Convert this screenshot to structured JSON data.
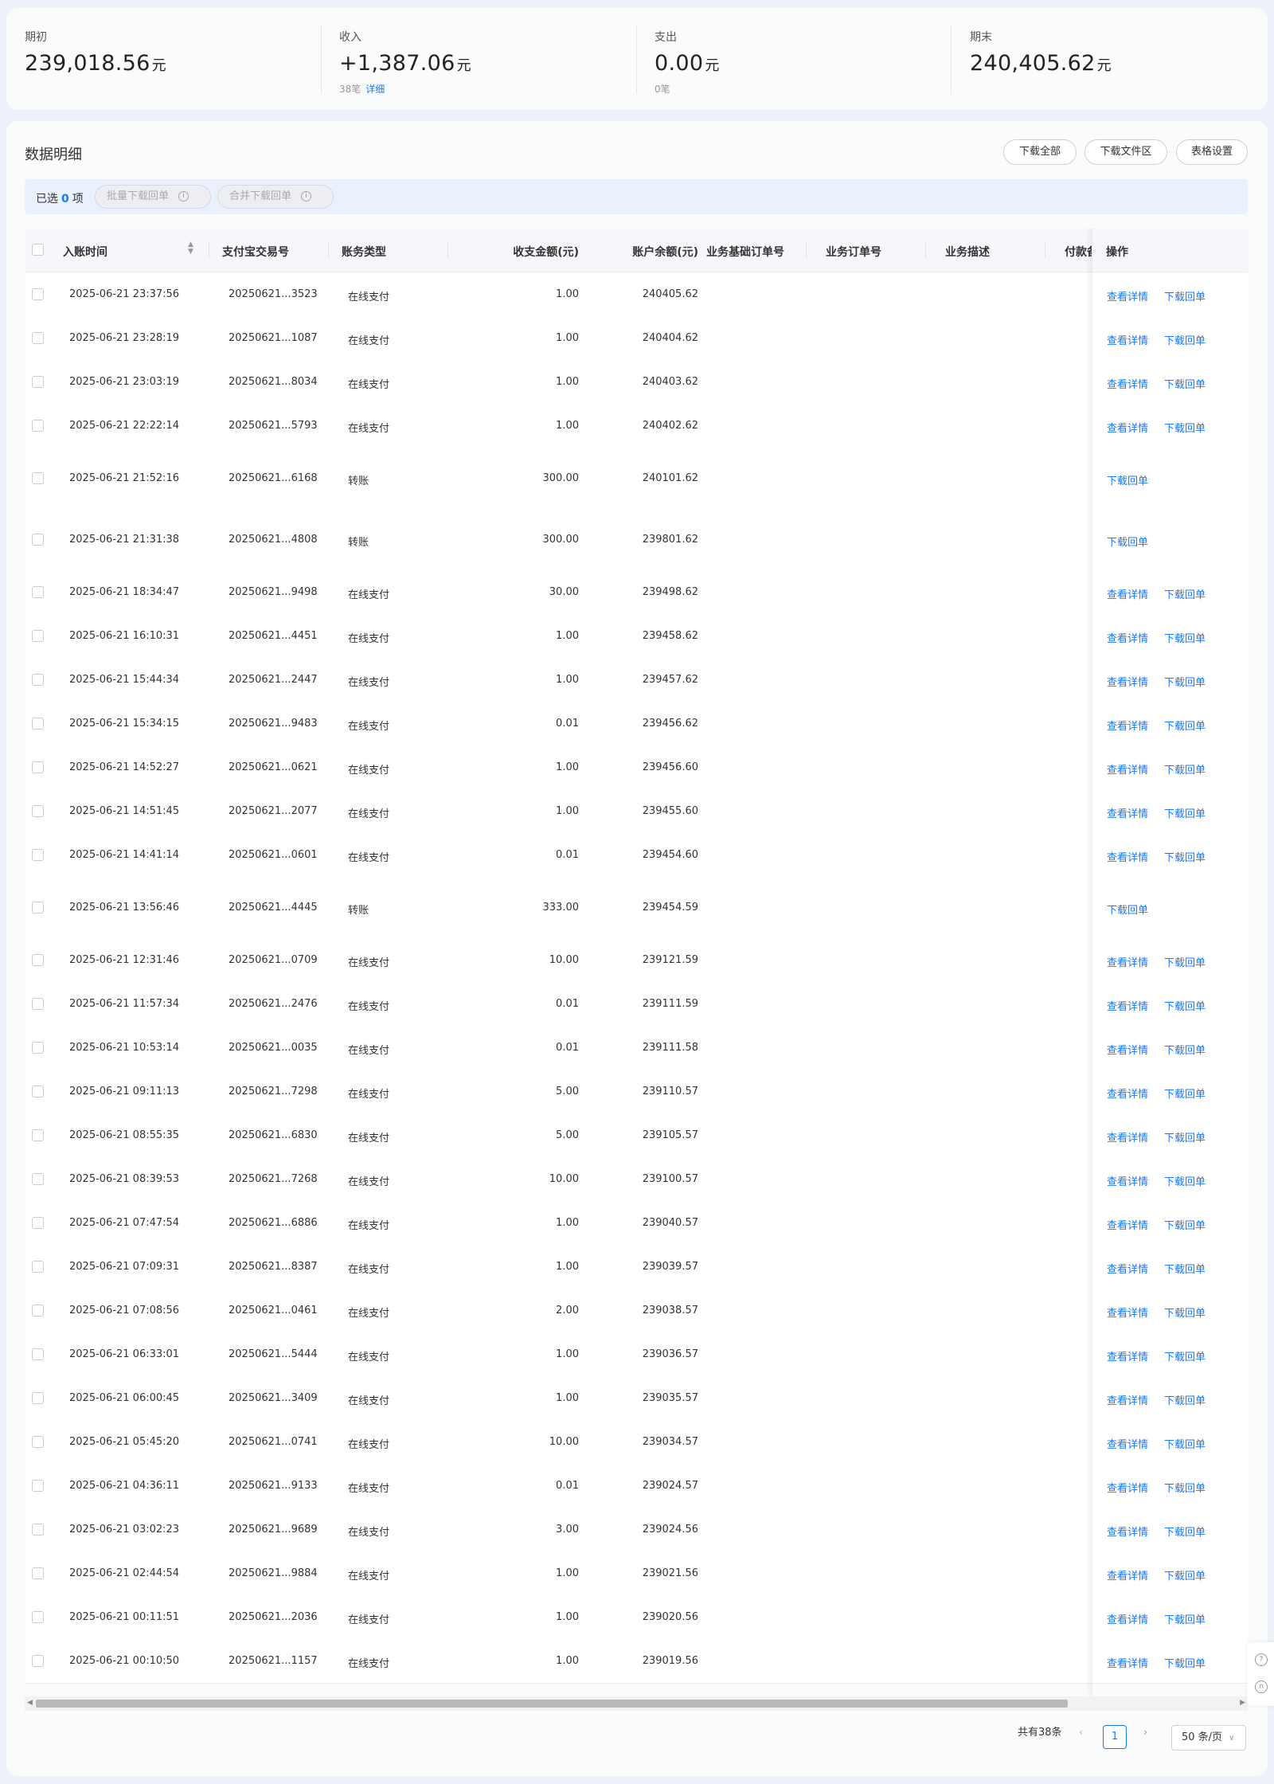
{
  "summary": [
    {
      "label": "期初",
      "value": "239,018.56",
      "unit": "元",
      "sub_count": "",
      "sub_link": ""
    },
    {
      "label": "收入",
      "value": "+1,387.06",
      "unit": "元",
      "sub_count": "38笔",
      "sub_link": "详细"
    },
    {
      "label": "支出",
      "value": "0.00",
      "unit": "元",
      "sub_count": "0笔",
      "sub_link": ""
    },
    {
      "label": "期末",
      "value": "240,405.62",
      "unit": "元",
      "sub_count": "",
      "sub_link": ""
    }
  ],
  "panel": {
    "title": "数据明细",
    "download_all": "下载全部",
    "download_files": "下载文件区",
    "table_settings": "表格设置"
  },
  "selection": {
    "prefix": "已选",
    "count": "0",
    "suffix": "项",
    "batch_download": "批量下载回单",
    "merge_download": "合并下载回单"
  },
  "columns": {
    "time": "入账时间",
    "trade_no": "支付宝交易号",
    "type": "账务类型",
    "amount": "收支金额(元)",
    "balance": "账户余额(元)",
    "base_order": "业务基础订单号",
    "order": "业务订单号",
    "desc": "业务描述",
    "payer": "付款备",
    "ops": "操作"
  },
  "row_ops": {
    "detail": "查看详情",
    "receipt": "下载回单"
  },
  "rows": [
    {
      "time": "2025-06-21 23:37:56",
      "trade_no": "20250621...3523",
      "type": "在线支付",
      "amount": "1.00",
      "balance": "240405.62",
      "detail": true
    },
    {
      "time": "2025-06-21 23:28:19",
      "trade_no": "20250621...1087",
      "type": "在线支付",
      "amount": "1.00",
      "balance": "240404.62",
      "detail": true
    },
    {
      "time": "2025-06-21 23:03:19",
      "trade_no": "20250621...8034",
      "type": "在线支付",
      "amount": "1.00",
      "balance": "240403.62",
      "detail": true
    },
    {
      "time": "2025-06-21 22:22:14",
      "trade_no": "20250621...5793",
      "type": "在线支付",
      "amount": "1.00",
      "balance": "240402.62",
      "detail": true
    },
    {
      "time": "2025-06-21 21:52:16",
      "trade_no": "20250621...6168",
      "type": "转账",
      "amount": "300.00",
      "balance": "240101.62",
      "detail": false
    },
    {
      "time": "2025-06-21 21:31:38",
      "trade_no": "20250621...4808",
      "type": "转账",
      "amount": "300.00",
      "balance": "239801.62",
      "detail": false
    },
    {
      "time": "2025-06-21 18:34:47",
      "trade_no": "20250621...9498",
      "type": "在线支付",
      "amount": "30.00",
      "balance": "239498.62",
      "detail": true
    },
    {
      "time": "2025-06-21 16:10:31",
      "trade_no": "20250621...4451",
      "type": "在线支付",
      "amount": "1.00",
      "balance": "239458.62",
      "detail": true
    },
    {
      "time": "2025-06-21 15:44:34",
      "trade_no": "20250621...2447",
      "type": "在线支付",
      "amount": "1.00",
      "balance": "239457.62",
      "detail": true
    },
    {
      "time": "2025-06-21 15:34:15",
      "trade_no": "20250621...9483",
      "type": "在线支付",
      "amount": "0.01",
      "balance": "239456.62",
      "detail": true
    },
    {
      "time": "2025-06-21 14:52:27",
      "trade_no": "20250621...0621",
      "type": "在线支付",
      "amount": "1.00",
      "balance": "239456.60",
      "detail": true
    },
    {
      "time": "2025-06-21 14:51:45",
      "trade_no": "20250621...2077",
      "type": "在线支付",
      "amount": "1.00",
      "balance": "239455.60",
      "detail": true
    },
    {
      "time": "2025-06-21 14:41:14",
      "trade_no": "20250621...0601",
      "type": "在线支付",
      "amount": "0.01",
      "balance": "239454.60",
      "detail": true
    },
    {
      "time": "2025-06-21 13:56:46",
      "trade_no": "20250621...4445",
      "type": "转账",
      "amount": "333.00",
      "balance": "239454.59",
      "detail": false
    },
    {
      "time": "2025-06-21 12:31:46",
      "trade_no": "20250621...0709",
      "type": "在线支付",
      "amount": "10.00",
      "balance": "239121.59",
      "detail": true
    },
    {
      "time": "2025-06-21 11:57:34",
      "trade_no": "20250621...2476",
      "type": "在线支付",
      "amount": "0.01",
      "balance": "239111.59",
      "detail": true
    },
    {
      "time": "2025-06-21 10:53:14",
      "trade_no": "20250621...0035",
      "type": "在线支付",
      "amount": "0.01",
      "balance": "239111.58",
      "detail": true
    },
    {
      "time": "2025-06-21 09:11:13",
      "trade_no": "20250621...7298",
      "type": "在线支付",
      "amount": "5.00",
      "balance": "239110.57",
      "detail": true
    },
    {
      "time": "2025-06-21 08:55:35",
      "trade_no": "20250621...6830",
      "type": "在线支付",
      "amount": "5.00",
      "balance": "239105.57",
      "detail": true
    },
    {
      "time": "2025-06-21 08:39:53",
      "trade_no": "20250621...7268",
      "type": "在线支付",
      "amount": "10.00",
      "balance": "239100.57",
      "detail": true
    },
    {
      "time": "2025-06-21 07:47:54",
      "trade_no": "20250621...6886",
      "type": "在线支付",
      "amount": "1.00",
      "balance": "239040.57",
      "detail": true
    },
    {
      "time": "2025-06-21 07:09:31",
      "trade_no": "20250621...8387",
      "type": "在线支付",
      "amount": "1.00",
      "balance": "239039.57",
      "detail": true
    },
    {
      "time": "2025-06-21 07:08:56",
      "trade_no": "20250621...0461",
      "type": "在线支付",
      "amount": "2.00",
      "balance": "239038.57",
      "detail": true
    },
    {
      "time": "2025-06-21 06:33:01",
      "trade_no": "20250621...5444",
      "type": "在线支付",
      "amount": "1.00",
      "balance": "239036.57",
      "detail": true
    },
    {
      "time": "2025-06-21 06:00:45",
      "trade_no": "20250621...3409",
      "type": "在线支付",
      "amount": "1.00",
      "balance": "239035.57",
      "detail": true
    },
    {
      "time": "2025-06-21 05:45:20",
      "trade_no": "20250621...0741",
      "type": "在线支付",
      "amount": "10.00",
      "balance": "239034.57",
      "detail": true
    },
    {
      "time": "2025-06-21 04:36:11",
      "trade_no": "20250621...9133",
      "type": "在线支付",
      "amount": "0.01",
      "balance": "239024.57",
      "detail": true
    },
    {
      "time": "2025-06-21 03:02:23",
      "trade_no": "20250621...9689",
      "type": "在线支付",
      "amount": "3.00",
      "balance": "239024.56",
      "detail": true
    },
    {
      "time": "2025-06-21 02:44:54",
      "trade_no": "20250621...9884",
      "type": "在线支付",
      "amount": "1.00",
      "balance": "239021.56",
      "detail": true
    },
    {
      "time": "2025-06-21 00:11:51",
      "trade_no": "20250621...2036",
      "type": "在线支付",
      "amount": "1.00",
      "balance": "239020.56",
      "detail": true
    },
    {
      "time": "2025-06-21 00:10:50",
      "trade_no": "20250621...1157",
      "type": "在线支付",
      "amount": "1.00",
      "balance": "239019.56",
      "detail": true
    }
  ],
  "pagination": {
    "total": "共有38条",
    "current_page": "1",
    "page_size": "50 条/页"
  },
  "colors": {
    "accent": "#1677ff",
    "panel_bg": "#fafbfd",
    "page_bg": "#eef1f7"
  }
}
